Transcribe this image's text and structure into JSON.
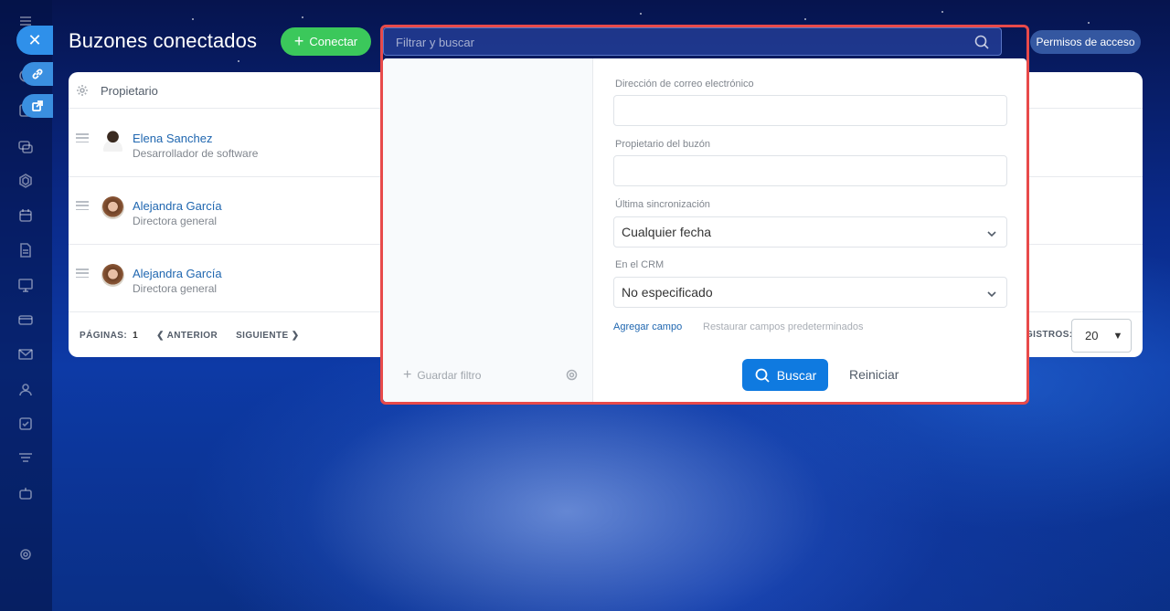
{
  "header": {
    "title": "Buzones conectados",
    "connect_label": "Conectar",
    "permissions_label": "Permisos de acceso"
  },
  "table": {
    "column_owner": "Propietario",
    "rows": [
      {
        "name": "Elena Sanchez",
        "role": "Desarrollador de software"
      },
      {
        "name": "Alejandra García",
        "role": "Directora general"
      },
      {
        "name": "Alejandra García",
        "role": "Directora general"
      }
    ],
    "pager": {
      "pages_label": "PÁGINAS:",
      "page_number": "1",
      "prev_label": "ANTERIOR",
      "next_label": "SIGUIENTE"
    },
    "records_label": "GISTROS:",
    "records_value": "20"
  },
  "filter": {
    "search_placeholder": "Filtrar y buscar",
    "save_filter_label": "Guardar filtro",
    "fields": {
      "email_label": "Dirección de correo electrónico",
      "owner_label": "Propietario del buzón",
      "sync_label": "Última sincronización",
      "sync_value": "Cualquier fecha",
      "crm_label": "En el CRM",
      "crm_value": "No especificado"
    },
    "add_field_label": "Agregar campo",
    "restore_label": "Restaurar campos predeterminados",
    "search_button": "Buscar",
    "reset_button": "Reiniciar"
  }
}
